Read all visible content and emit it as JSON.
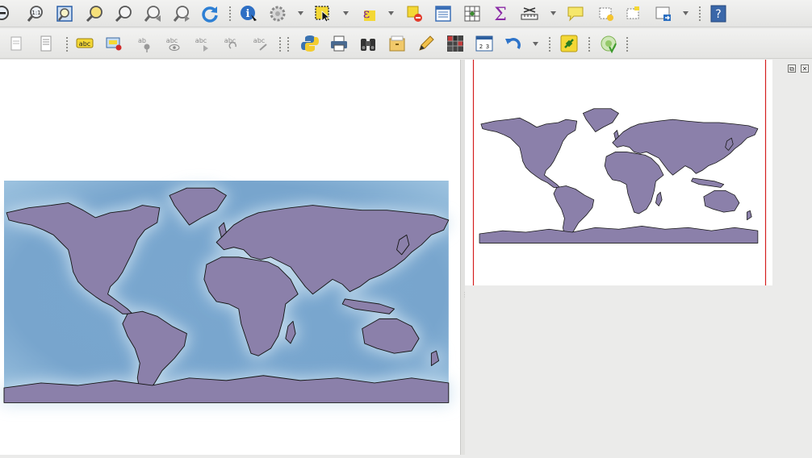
{
  "colors": {
    "land": "#8b80aa",
    "land_stroke": "#151515",
    "ocean": "#7aa7cf",
    "ocean_glow": "#cfe3f1",
    "extent_box": "#d51f1f",
    "toolbar_bg": "#ececea"
  },
  "toolbar_top": {
    "buttons": [
      {
        "name": "zoom-out-icon"
      },
      {
        "name": "zoom-native-resolution-icon"
      },
      {
        "name": "zoom-full-icon"
      },
      {
        "name": "zoom-to-selection-icon"
      },
      {
        "name": "zoom-to-layer-icon"
      },
      {
        "name": "zoom-last-icon"
      },
      {
        "name": "zoom-next-icon"
      },
      {
        "name": "refresh-icon"
      },
      {
        "name": "identify-features-icon"
      },
      {
        "name": "run-feature-action-icon"
      },
      {
        "name": "select-features-icon"
      },
      {
        "name": "select-by-expression-icon"
      },
      {
        "name": "deselect-all-icon"
      },
      {
        "name": "attribute-table-icon"
      },
      {
        "name": "field-calculator-icon"
      },
      {
        "name": "statistical-summary-icon"
      },
      {
        "name": "measure-line-icon"
      },
      {
        "name": "text-annotation-icon"
      },
      {
        "name": "new-bookmark-icon"
      },
      {
        "name": "show-bookmarks-icon"
      },
      {
        "name": "map-tips-icon"
      },
      {
        "name": "whats-this-help-icon"
      }
    ]
  },
  "toolbar_bottom": {
    "buttons": [
      {
        "name": "new-print-composer-icon"
      },
      {
        "name": "composer-manager-icon"
      },
      {
        "name": "layer-labeling-icon"
      },
      {
        "name": "layer-diagram-icon"
      },
      {
        "name": "pin-labels-icon"
      },
      {
        "name": "show-hide-labels-icon"
      },
      {
        "name": "move-label-icon"
      },
      {
        "name": "rotate-label-icon"
      },
      {
        "name": "change-label-icon"
      },
      {
        "name": "python-console-icon"
      },
      {
        "name": "print-icon"
      },
      {
        "name": "binoculars-search-icon"
      },
      {
        "name": "archive-folder-icon"
      },
      {
        "name": "pencil-icon"
      },
      {
        "name": "raster-grid-icon"
      },
      {
        "name": "numbered-grid-icon"
      },
      {
        "name": "undo-icon"
      },
      {
        "name": "plugin-manager-icon"
      },
      {
        "name": "georeferencer-icon"
      }
    ]
  },
  "overview_panel": {
    "float_label": "⧉",
    "close_label": "✕"
  }
}
